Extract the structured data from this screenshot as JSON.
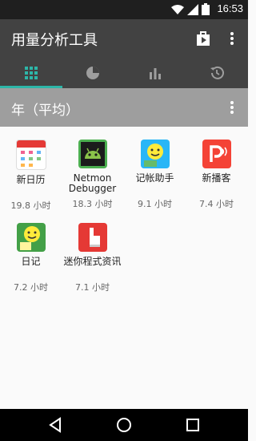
{
  "status": {
    "time": "16:53"
  },
  "appbar": {
    "title": "用量分析工具"
  },
  "tabs": [
    {
      "name": "grid"
    },
    {
      "name": "pie"
    },
    {
      "name": "bar"
    },
    {
      "name": "history"
    }
  ],
  "section": {
    "title": "年（平均）"
  },
  "apps": [
    {
      "name": "新日历",
      "usage": "19.8 小时",
      "icon": "calendar-icon"
    },
    {
      "name": "Netmon Debugger",
      "usage": "18.3 小时",
      "icon": "android-icon"
    },
    {
      "name": "记帐助手",
      "usage": "9.1 小时",
      "icon": "smiley-money-icon"
    },
    {
      "name": "新播客",
      "usage": "7.4 小时",
      "icon": "podcast-icon"
    },
    {
      "name": "日记",
      "usage": "7.2 小时",
      "icon": "diary-icon"
    },
    {
      "name": "迷你程式资讯",
      "usage": "7.1 小时",
      "icon": "pointer-icon"
    }
  ],
  "colors": {
    "accent": "#2db6a8",
    "appbar": "#424242",
    "section": "#9e9e9e"
  }
}
